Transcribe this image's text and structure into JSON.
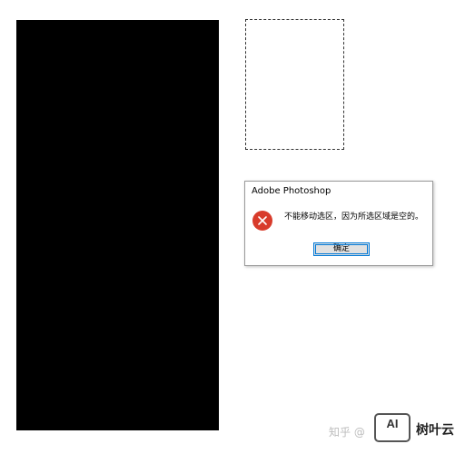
{
  "canvas": {
    "background_color": "#000000"
  },
  "dialog": {
    "title": "Adobe Photoshop",
    "message": "不能移动选区，因为所选区域是空的。",
    "ok_label": "确定",
    "icon": "error-icon",
    "icon_color": "#d83b2b"
  },
  "watermark": {
    "text": "知乎 @"
  },
  "logo": {
    "mark": "AI",
    "name": "树叶云"
  }
}
